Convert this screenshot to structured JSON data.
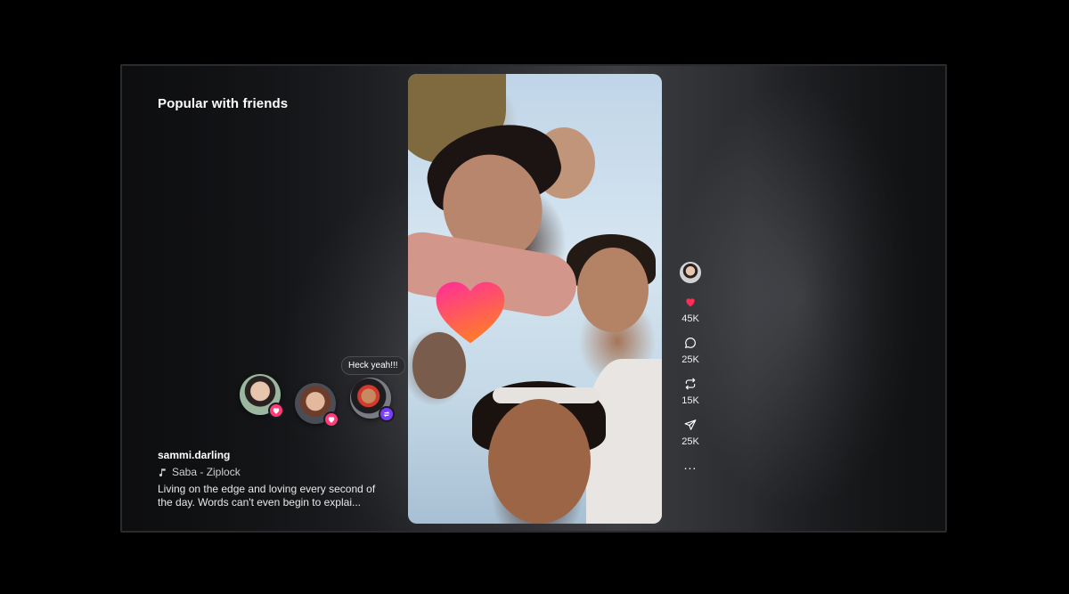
{
  "section": {
    "title": "Popular with friends"
  },
  "friends_reactions": {
    "bubble_text": "Heck yeah!!!",
    "avatars": [
      {
        "icon": "heart-icon",
        "badge_color": "#ff3c77"
      },
      {
        "icon": "heart-icon",
        "badge_color": "#ff3c77"
      },
      {
        "icon": "repost-icon",
        "badge_color": "#7a3cff"
      }
    ]
  },
  "post": {
    "username": "sammi.darling",
    "song_icon": "music-note-icon",
    "song": "Saba - Ziplock",
    "caption": "Living on the edge and loving every second of the day. Words can't even begin to explai..."
  },
  "actions": {
    "like": {
      "icon": "heart-icon",
      "count": "45K",
      "color": "#ff2d55"
    },
    "comment": {
      "icon": "comment-icon",
      "count": "25K"
    },
    "repost": {
      "icon": "repost-icon",
      "count": "15K"
    },
    "share": {
      "icon": "send-icon",
      "count": "25K"
    },
    "more": {
      "icon": "more-icon",
      "label": "..."
    }
  },
  "colors": {
    "accent_heart_top": "#ff2d9b",
    "accent_heart_bottom": "#ff7a2d",
    "background": "#000000"
  }
}
